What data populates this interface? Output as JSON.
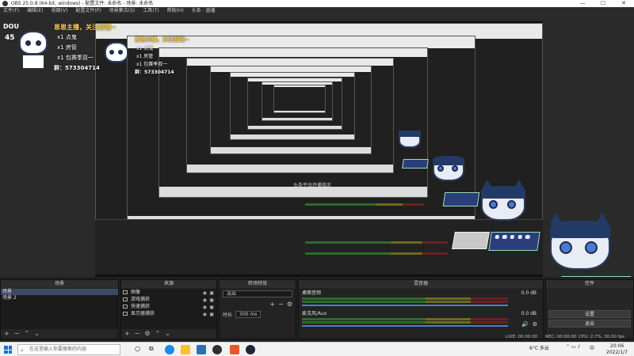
{
  "window": {
    "title": "OBS 25.0.8 (64-bit, windows) - 配置文件: 未命名 - 场景: 未命名",
    "controls": [
      "—",
      "☐",
      "✕"
    ]
  },
  "menu": [
    "文件(F)",
    "编辑(E)",
    "视图(V)",
    "配置文件(P)",
    "场景集合(S)",
    "工具(T)",
    "帮助(H)",
    "头条 · 直播"
  ],
  "overlay": {
    "title": "恩恩主播，关注我哦~",
    "rows": [
      {
        "count": "x1",
        "label": "点鬼"
      },
      {
        "count": "x1",
        "label": "房管"
      },
      {
        "count": "x1",
        "label": "包赛季双一"
      }
    ],
    "group": "群：573304714",
    "brand": "DOU",
    "side_number": "45"
  },
  "nested_caption": "头条平台开播指北",
  "docks": {
    "scenes": {
      "title": "场景",
      "items": [
        "场景",
        "场景 2"
      ],
      "selected": 0
    },
    "sources": {
      "title": "来源",
      "items": [
        "图像",
        "游戏捕获",
        "快速捕获",
        "显示器捕获"
      ]
    },
    "transitions": {
      "title": "转场特效",
      "type": "淡出",
      "duration_label": "时长",
      "duration": "300 ms"
    },
    "mixer": {
      "title": "混音器",
      "channels": [
        {
          "name": "桌面音频",
          "db": "0.0 dB"
        },
        {
          "name": "麦克风/Aux",
          "db": "0.0 dB"
        }
      ]
    },
    "controls": {
      "title": "控件",
      "buttons": [
        "设置",
        "退出"
      ]
    }
  },
  "status": {
    "live": "LIVE: 00:00:00",
    "rec": "REC: 00:00:00",
    "cpu": "CPU: 2.7%, 30.00 fps"
  },
  "taskbar": {
    "search_placeholder": "在这里输入你要搜索的内容",
    "weather": "6°C 多云",
    "ime": "中",
    "time": "20:06",
    "date": "2022/1/7"
  },
  "colors": {
    "accent": "#4e7bd6",
    "overlay_title": "#ffd54a",
    "cat_hair": "#243a66",
    "deck": "#2a3e7a"
  },
  "icons": [
    "search-icon",
    "windows-icon",
    "eye-icon",
    "lock-icon",
    "gear-icon",
    "plus-icon",
    "minus-icon",
    "volume-icon"
  ]
}
